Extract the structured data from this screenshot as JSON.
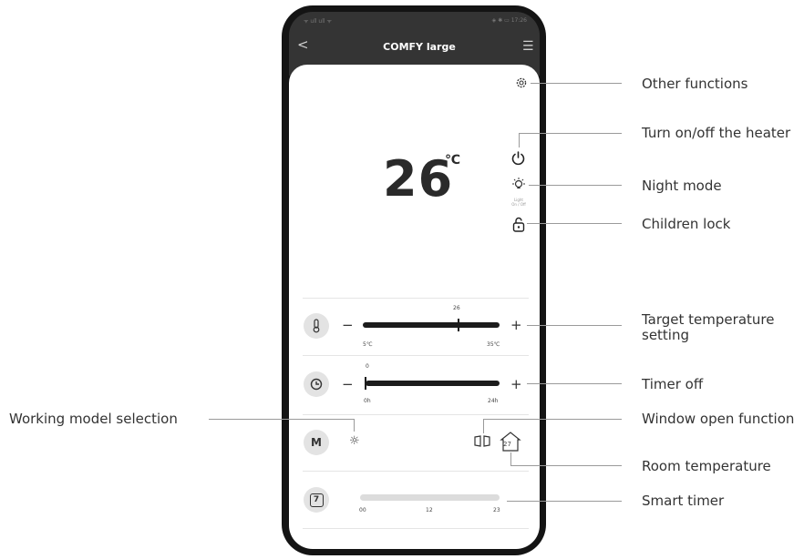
{
  "app": {
    "title": "COMFY large"
  },
  "statusbar": {
    "left": "ᯤ ull ull ᯤ",
    "right": "◈ ✱ ▭ 17:26"
  },
  "display": {
    "temperature": "26",
    "unit": "℃"
  },
  "light_caption": "Light\nOn / Off",
  "target_slider": {
    "value": "26",
    "min_label": "5℃",
    "max_label": "35℃",
    "min": 5,
    "max": 35,
    "current": 26
  },
  "timer_slider": {
    "value": "0",
    "min_label": "0h",
    "max_label": "24h",
    "min": 0,
    "max": 24,
    "current": 0
  },
  "mode_badge": "M",
  "room_temp": "27",
  "smart_timer": {
    "icon_text": "7",
    "ticks": [
      "00",
      "12",
      "23"
    ]
  },
  "callouts": {
    "other_functions": "Other functions",
    "power": "Turn on/off the heater",
    "night_mode": "Night mode",
    "children_lock": "Children lock",
    "target_temp": "Target temperature\nsetting",
    "timer_off": "Timer off",
    "working_model": "Working model selection",
    "window_open": "Window open function",
    "room_temperature": "Room temperature",
    "smart_timer": "Smart timer"
  },
  "icons": {
    "back": "back-chevron-icon",
    "menu": "menu-icon",
    "settings": "gear-icon",
    "power": "power-icon",
    "night": "bulb-icon",
    "lock": "lock-icon",
    "thermometer": "thermometer-icon",
    "clock": "clock-icon",
    "sun": "sun-icon",
    "window": "window-icon",
    "house": "house-icon"
  }
}
